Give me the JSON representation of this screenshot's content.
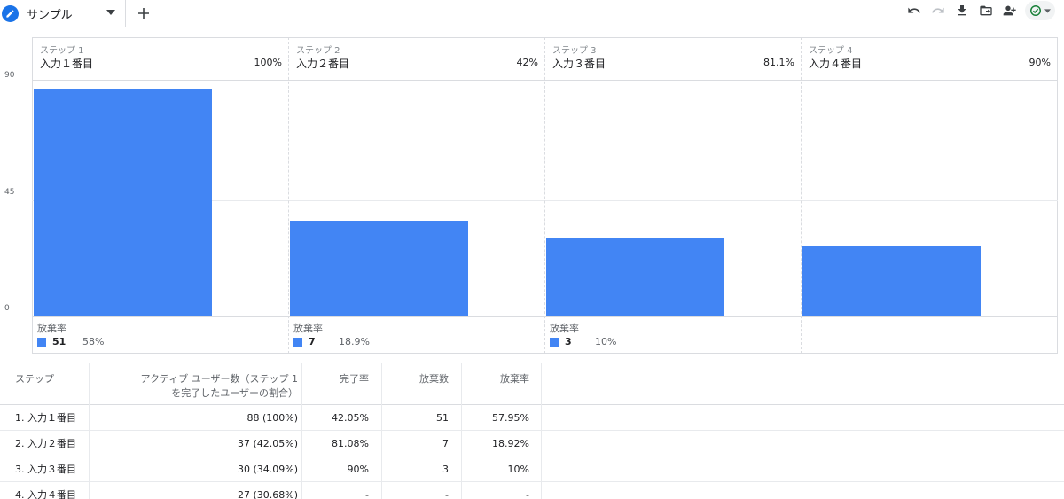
{
  "toolbar": {
    "tab_name": "サンプル",
    "add_tab_label": "+"
  },
  "colors": {
    "bar": "#4285f4",
    "accent": "#1a73e8",
    "status_check": "#188038"
  },
  "chart_data": {
    "type": "bar",
    "title": "",
    "categories": [
      "入力１番目",
      "入力２番目",
      "入力３番目",
      "入力４番目"
    ],
    "step_labels": [
      "ステップ 1",
      "ステップ 2",
      "ステップ 3",
      "ステップ 4"
    ],
    "completion_pcts": [
      "100%",
      "42%",
      "81.1%",
      "90%"
    ],
    "values": [
      88,
      37,
      30,
      27
    ],
    "ylim": [
      0,
      90
    ],
    "yticks": [
      "90",
      "45",
      "0"
    ],
    "abandonment_label": "放棄率",
    "abandonment": [
      {
        "count": "51",
        "rate": "58%"
      },
      {
        "count": "7",
        "rate": "18.9%"
      },
      {
        "count": "3",
        "rate": "10%"
      },
      null
    ],
    "grid": true
  },
  "table": {
    "headers": [
      "ステップ",
      "アクティブ ユーザー数（ステップ 1",
      "を完了したユーザーの割合）",
      "完了率",
      "放棄数",
      "放棄率"
    ],
    "rows": [
      [
        "1. 入力１番目",
        "88 (100%)",
        "42.05%",
        "51",
        "57.95%"
      ],
      [
        "2. 入力２番目",
        "37 (42.05%)",
        "81.08%",
        "7",
        "18.92%"
      ],
      [
        "3. 入力３番目",
        "30 (34.09%)",
        "90%",
        "3",
        "10%"
      ],
      [
        "4. 入力４番目",
        "27 (30.68%)",
        "-",
        "-",
        "-"
      ]
    ]
  }
}
